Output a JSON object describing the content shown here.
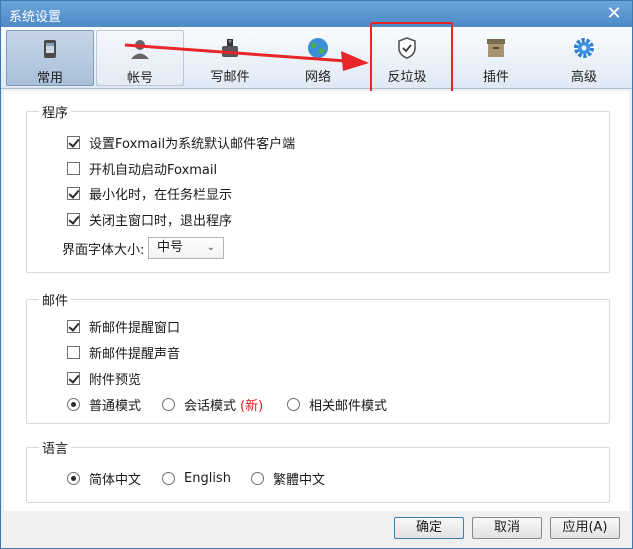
{
  "window": {
    "title": "系统设置"
  },
  "toolbar": {
    "tabs": [
      {
        "label": "常用",
        "icon": "phone-icon",
        "state": "active"
      },
      {
        "label": "帐号",
        "icon": "person-icon",
        "state": "hover"
      },
      {
        "label": "写邮件",
        "icon": "compose-icon",
        "state": "normal"
      },
      {
        "label": "网络",
        "icon": "globe-icon",
        "state": "normal"
      },
      {
        "label": "反垃圾",
        "icon": "shield-icon",
        "state": "normal"
      },
      {
        "label": "插件",
        "icon": "box-icon",
        "state": "normal"
      },
      {
        "label": "高级",
        "icon": "gear-icon",
        "state": "normal"
      }
    ]
  },
  "program": {
    "title": "程序",
    "options": [
      {
        "label": "设置Foxmail为系统默认邮件客户端",
        "checked": true
      },
      {
        "label": "开机自动启动Foxmail",
        "checked": false
      },
      {
        "label": "最小化时，在任务栏显示",
        "checked": true
      },
      {
        "label": "关闭主窗口时，退出程序",
        "checked": true
      }
    ],
    "font_size_label": "界面字体大小:",
    "font_size_value": "中号"
  },
  "mail": {
    "title": "邮件",
    "options": [
      {
        "label": "新邮件提醒窗口",
        "checked": true
      },
      {
        "label": "新邮件提醒声音",
        "checked": false
      },
      {
        "label": "附件预览",
        "checked": true
      }
    ],
    "modes": [
      {
        "label": "普通模式",
        "checked": true
      },
      {
        "label": "会话模式",
        "checked": false,
        "tag": "(新)"
      },
      {
        "label": "相关邮件模式",
        "checked": false
      }
    ]
  },
  "language": {
    "title": "语言",
    "options": [
      {
        "label": "简体中文",
        "checked": true
      },
      {
        "label": "English",
        "checked": false
      },
      {
        "label": "繁體中文",
        "checked": false
      }
    ]
  },
  "buttons": {
    "ok": "确定",
    "cancel": "取消",
    "apply": "应用(A)"
  },
  "colors": {
    "accent": "#4d8ac6",
    "annotation": "#e8262a",
    "new_tag": "#e02020"
  }
}
